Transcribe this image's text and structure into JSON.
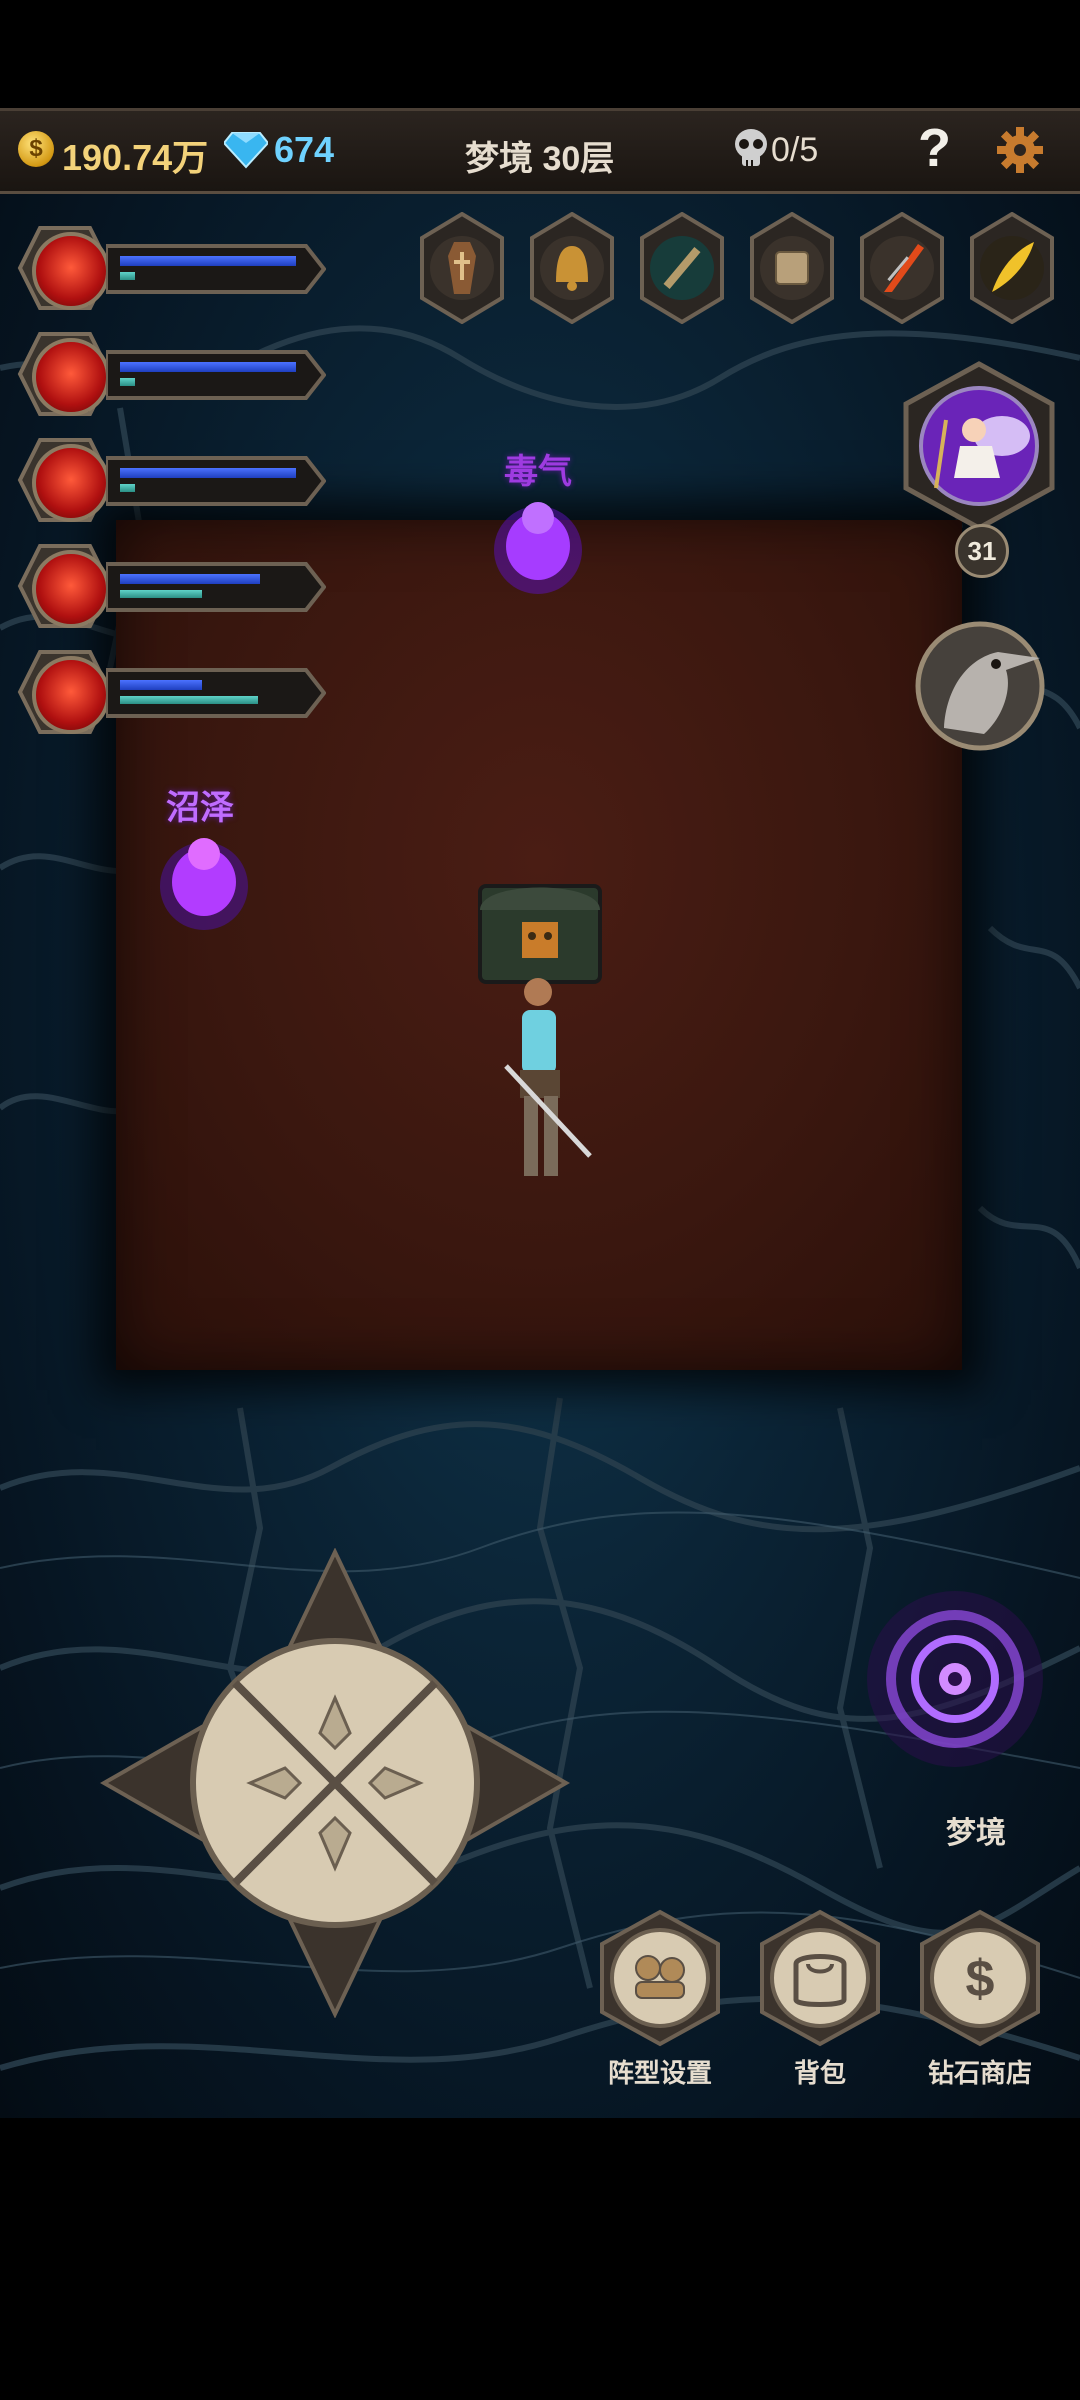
{
  "topbar": {
    "coin_symbol": "$",
    "gold": "190.74万",
    "gems": "674",
    "floor": "梦境 30层",
    "kills": "0/5",
    "help": "?"
  },
  "heroes": [
    {
      "hp": 0.82,
      "mp": 0.07
    },
    {
      "hp": 0.82,
      "mp": 0.07
    },
    {
      "hp": 0.82,
      "mp": 0.07
    },
    {
      "hp": 0.65,
      "mp": 0.38
    },
    {
      "hp": 0.38,
      "mp": 0.64
    }
  ],
  "relics": [
    "coffin-icon",
    "bell-icon",
    "flute-icon",
    "dice-icon",
    "carrot-spear-icon",
    "feather-icon"
  ],
  "boss": {
    "level": "31"
  },
  "mobs": [
    {
      "label": "毒气"
    },
    {
      "label": "沼泽"
    }
  ],
  "dream": {
    "label": "梦境"
  },
  "menu": [
    {
      "label": "阵型设置",
      "icon": "formation-icon"
    },
    {
      "label": "背包",
      "icon": "backpack-icon"
    },
    {
      "label": "钻石商店",
      "icon": "diamond-shop-icon"
    }
  ],
  "colors": {
    "hp": "#3b62ff",
    "mp": "#49c2b6",
    "mob": "#b14dff",
    "accent_gold": "#f3d27a",
    "accent_gem": "#6fd2ff"
  }
}
